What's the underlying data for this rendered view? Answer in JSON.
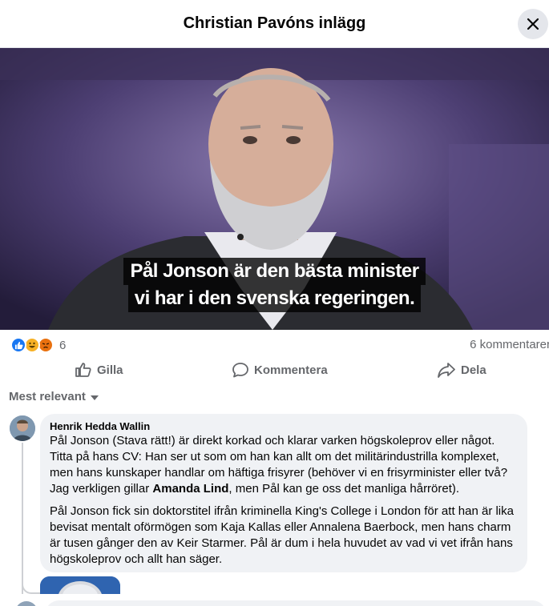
{
  "header": {
    "title": "Christian Pavóns inlägg",
    "close_icon": "close-icon"
  },
  "video": {
    "caption_line1": "Pål Jonson är den bästa minister",
    "caption_line2": "vi har i den svenska regeringen."
  },
  "stats": {
    "reaction_icons": [
      "like-icon",
      "haha-icon",
      "angry-icon"
    ],
    "reaction_count": "6",
    "comment_count": "6 kommentarer"
  },
  "actions": {
    "like": "Gilla",
    "comment": "Kommentera",
    "share": "Dela"
  },
  "sort": {
    "label": "Mest relevant"
  },
  "comment": {
    "author": "Henrik Hedda Wallin",
    "p1_line1": "Pål Jonson (Stava rätt!) är direkt korkad och klarar varken högskoleprov eller något.",
    "p1_line2": "Titta på hans CV: Han ser ut som om han kan allt om det militärindustrilla komplexet,",
    "p1_line3": "men hans kunskaper handlar om häftiga frisyrer (behöver vi en frisyrminister eller två?",
    "p1_line4_pre": "Jag verkligen gillar ",
    "p1_line4_bold": "Amanda Lind",
    "p1_line4_post": ", men Pål kan ge oss det manliga hårröret).",
    "p2_line1": "Pål Jonson fick sin doktorstitel ifrån kriminella King's College i London för att han är lika",
    "p2_line2": "bevisat mentalt oförmögen som Kaja Kallas eller Annalena Baerbock, men hans charm",
    "p2_line3": "är tusen gånger den av Keir Starmer. Pål är dum i hela huvudet av vad vi vet ifrån hans",
    "p2_line4": "högskoleprov och allt han säger."
  },
  "colors": {
    "accent": "#1877f2",
    "muted": "#65676b",
    "bubble": "#f0f2f5"
  }
}
